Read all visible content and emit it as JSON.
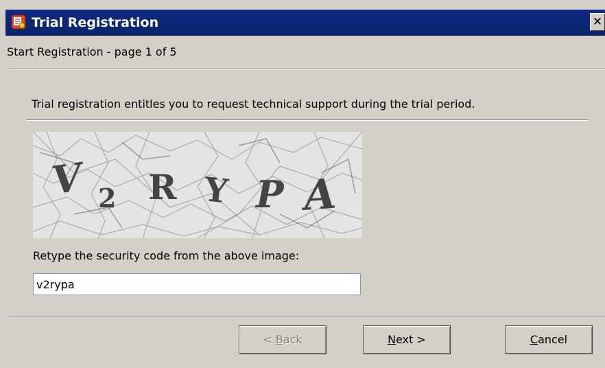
{
  "window": {
    "title": "Trial Registration",
    "close_glyph": "✕",
    "icon": "registration-app-icon"
  },
  "page": {
    "heading": "Start Registration - page 1 of 5",
    "intro": "Trial registration entitles you to request technical support during the trial period."
  },
  "captcha": {
    "characters": [
      "V",
      "2",
      "R",
      "Y",
      "P",
      "A"
    ]
  },
  "form": {
    "retype_label": "Retype the security code from the above image:",
    "code_value": "v2rypa"
  },
  "buttons": {
    "back": {
      "prefix": "< ",
      "mnemonic": "B",
      "rest": "ack",
      "enabled": false
    },
    "next": {
      "mnemonic": "N",
      "rest": "ext >",
      "enabled": true
    },
    "cancel": {
      "mnemonic": "C",
      "rest": "ancel",
      "enabled": true
    }
  },
  "colors": {
    "titlebar": "#0a246a",
    "dialog_bg": "#d4d0c8",
    "disabled_text": "#808080"
  }
}
